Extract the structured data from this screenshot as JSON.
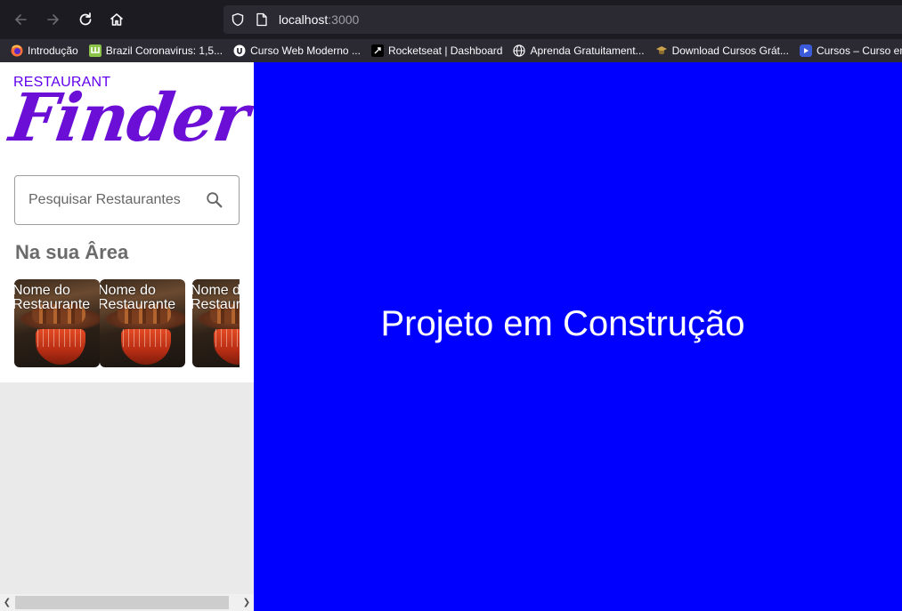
{
  "browser": {
    "url_host": "localhost",
    "url_port": ":3000",
    "bookmarks": [
      {
        "label": "Introdução",
        "icon": "firefox-icon",
        "color": "#ff7139"
      },
      {
        "label": "Brazil Coronavirus: 1,5...",
        "icon": "worldometer-icon",
        "color": "#8bc34a"
      },
      {
        "label": "Curso Web Moderno ...",
        "icon": "cod3r-icon",
        "color": "#ffffff"
      },
      {
        "label": "Rocketseat | Dashboard",
        "icon": "rocketseat-icon",
        "color": "#000000"
      },
      {
        "label": "Aprenda Gratuitament...",
        "icon": "globe-icon",
        "color": "#fbfbfe"
      },
      {
        "label": "Download Cursos Grát...",
        "icon": "graduation-cap-icon",
        "color": "#c9a14a"
      },
      {
        "label": "Cursos – Curso em",
        "icon": "curso-em-video-icon",
        "color": "#3b5bdb"
      }
    ]
  },
  "sidebar": {
    "logo_small": "RESTAURANT",
    "logo_big": "Finder",
    "search_placeholder": "Pesquisar Restaurantes",
    "section_title": "Na sua Ârea",
    "cards": [
      {
        "label": "Nome do Restaurante"
      },
      {
        "label": "Nome do Restaurante"
      },
      {
        "label": "Nome do Restaurante"
      }
    ]
  },
  "main": {
    "message": "Projeto em Construção",
    "background": "#0000ff"
  },
  "colors": {
    "brand": "#6200ee",
    "chrome_dark": "#1c1b22",
    "chrome_mid": "#2b2a33"
  }
}
